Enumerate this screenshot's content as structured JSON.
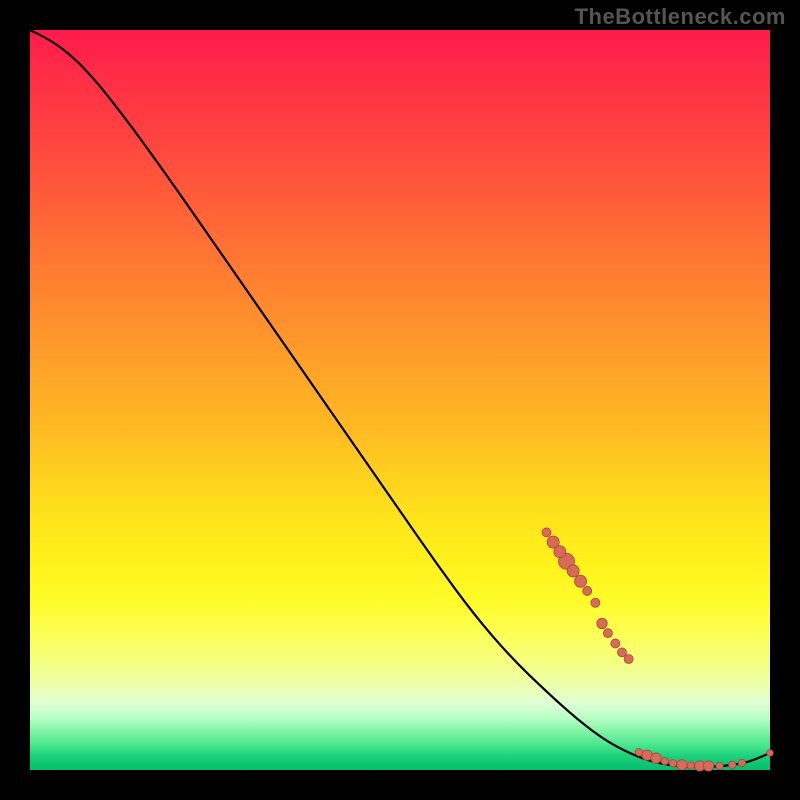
{
  "watermark": "TheBottleneck.com",
  "colors": {
    "background": "#000000",
    "curve_stroke": "#000000",
    "marker_fill": "#d86a5a",
    "marker_stroke": "#a8463b"
  },
  "chart_data": {
    "type": "line",
    "title": "",
    "xlabel": "",
    "ylabel": "",
    "xlim": [
      0,
      100
    ],
    "ylim": [
      0,
      100
    ],
    "grid": false,
    "legend": false,
    "curve": [
      {
        "x": 0,
        "y": 100
      },
      {
        "x": 3,
        "y": 98.5
      },
      {
        "x": 6,
        "y": 96.2
      },
      {
        "x": 9,
        "y": 93.0
      },
      {
        "x": 12,
        "y": 89.2
      },
      {
        "x": 15,
        "y": 85.2
      },
      {
        "x": 20,
        "y": 78.2
      },
      {
        "x": 25,
        "y": 71.0
      },
      {
        "x": 30,
        "y": 63.8
      },
      {
        "x": 35,
        "y": 56.6
      },
      {
        "x": 40,
        "y": 49.4
      },
      {
        "x": 45,
        "y": 42.2
      },
      {
        "x": 50,
        "y": 35.0
      },
      {
        "x": 55,
        "y": 27.8
      },
      {
        "x": 60,
        "y": 21.0
      },
      {
        "x": 65,
        "y": 15.2
      },
      {
        "x": 70,
        "y": 10.4
      },
      {
        "x": 74,
        "y": 6.8
      },
      {
        "x": 78,
        "y": 3.8
      },
      {
        "x": 82,
        "y": 1.8
      },
      {
        "x": 85,
        "y": 0.9
      },
      {
        "x": 88,
        "y": 0.45
      },
      {
        "x": 91,
        "y": 0.4
      },
      {
        "x": 94,
        "y": 0.55
      },
      {
        "x": 97,
        "y": 1.0
      },
      {
        "x": 100,
        "y": 2.3
      }
    ],
    "marker_groups": [
      {
        "r": 8,
        "points": [
          {
            "x": 72.5,
            "y": 28.2
          }
        ]
      },
      {
        "r": 6,
        "points": [
          {
            "x": 70.7,
            "y": 30.8
          },
          {
            "x": 71.6,
            "y": 29.5
          },
          {
            "x": 73.4,
            "y": 26.9
          },
          {
            "x": 74.4,
            "y": 25.5
          }
        ]
      },
      {
        "r": 4.5,
        "points": [
          {
            "x": 69.8,
            "y": 32.1
          },
          {
            "x": 75.3,
            "y": 24.2
          },
          {
            "x": 76.4,
            "y": 22.6
          },
          {
            "x": 78.1,
            "y": 18.5
          },
          {
            "x": 79.1,
            "y": 17.1
          },
          {
            "x": 80.0,
            "y": 15.9
          },
          {
            "x": 80.9,
            "y": 15.0
          }
        ]
      },
      {
        "r": 5.2,
        "points": [
          {
            "x": 77.3,
            "y": 19.8
          }
        ]
      },
      {
        "r": 3.7,
        "points": [
          {
            "x": 82.3,
            "y": 2.4
          },
          {
            "x": 85.8,
            "y": 1.2
          },
          {
            "x": 86.9,
            "y": 0.9
          },
          {
            "x": 89.3,
            "y": 0.6
          },
          {
            "x": 93.2,
            "y": 0.55
          }
        ]
      },
      {
        "r": 5.2,
        "points": [
          {
            "x": 83.4,
            "y": 2.0
          },
          {
            "x": 84.6,
            "y": 1.6
          },
          {
            "x": 88.1,
            "y": 0.7
          },
          {
            "x": 90.5,
            "y": 0.55
          },
          {
            "x": 91.7,
            "y": 0.55
          }
        ]
      },
      {
        "r": 3.7,
        "points": [
          {
            "x": 94.9,
            "y": 0.7
          },
          {
            "x": 96.2,
            "y": 0.95
          }
        ]
      },
      {
        "r": 3.3,
        "points": [
          {
            "x": 100.0,
            "y": 2.3
          }
        ]
      }
    ]
  }
}
